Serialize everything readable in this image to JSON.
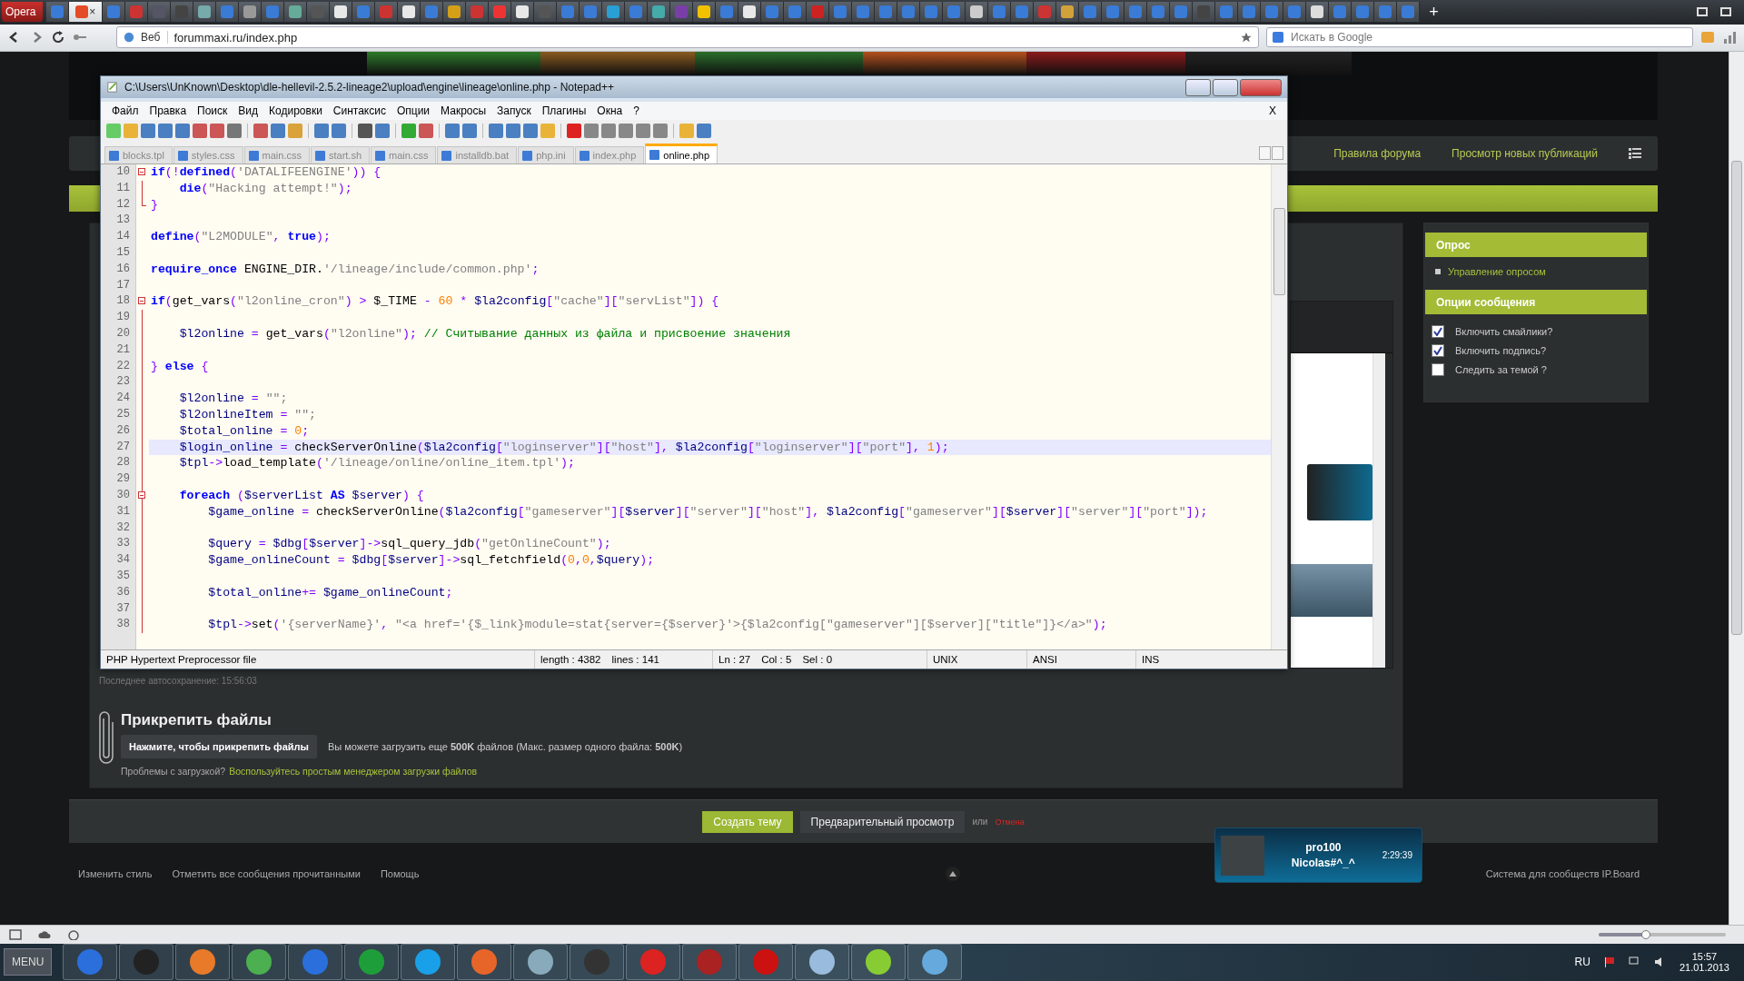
{
  "browser": {
    "menu_button": "Opera",
    "tabs": [
      {
        "selected": false
      },
      {
        "selected": true,
        "close": "×"
      },
      {
        "selected": false
      },
      {
        "selected": false
      },
      {
        "selected": false
      },
      {
        "selected": false
      },
      {
        "selected": false
      },
      {
        "selected": false
      },
      {
        "selected": false
      },
      {
        "selected": false
      },
      {
        "selected": false
      },
      {
        "selected": false
      },
      {
        "selected": false
      },
      {
        "selected": false
      },
      {
        "selected": false
      },
      {
        "selected": false
      },
      {
        "selected": false
      },
      {
        "selected": false
      },
      {
        "selected": false
      },
      {
        "selected": false
      },
      {
        "selected": false
      },
      {
        "selected": false
      },
      {
        "selected": false
      },
      {
        "selected": false
      },
      {
        "selected": false
      },
      {
        "selected": false
      },
      {
        "selected": false
      },
      {
        "selected": false
      },
      {
        "selected": false
      },
      {
        "selected": false
      },
      {
        "selected": false
      },
      {
        "selected": false
      },
      {
        "selected": false
      },
      {
        "selected": false
      },
      {
        "selected": false
      },
      {
        "selected": false
      },
      {
        "selected": false
      },
      {
        "selected": false
      },
      {
        "selected": false
      },
      {
        "selected": false
      },
      {
        "selected": false
      },
      {
        "selected": false
      },
      {
        "selected": false
      },
      {
        "selected": false
      },
      {
        "selected": false
      },
      {
        "selected": false
      },
      {
        "selected": false
      },
      {
        "selected": false
      },
      {
        "selected": false
      },
      {
        "selected": false
      },
      {
        "selected": false
      },
      {
        "selected": false
      },
      {
        "selected": false
      },
      {
        "selected": false
      },
      {
        "selected": false
      },
      {
        "selected": false
      },
      {
        "selected": false
      },
      {
        "selected": false
      },
      {
        "selected": false
      },
      {
        "selected": false
      }
    ],
    "new_tab": "+",
    "address": {
      "label": "Веб",
      "url": "forummaxi.ru/index.php"
    },
    "search": {
      "placeholder": "Искать в Google"
    },
    "zoom_slider": {
      "level": 0.37
    }
  },
  "forum": {
    "nav_links": [
      "Правила форума",
      "Просмотр новых публикаций"
    ],
    "sidebar": [
      {
        "title": "Опрос",
        "kind": "links",
        "items": [
          {
            "label": "Управление опросом"
          }
        ]
      },
      {
        "title": "Опции сообщения",
        "kind": "checkboxes",
        "items": [
          {
            "label": "Включить смайлики?",
            "checked": true
          },
          {
            "label": "Включить подпись?",
            "checked": true
          },
          {
            "label": "Следить за темой ?",
            "checked": false
          }
        ]
      }
    ],
    "autosave": "Последнее автосохранение: 15:56:03",
    "attach": {
      "title": "Прикрепить файлы",
      "button": "Нажмите, чтобы прикрепить файлы",
      "info": "Вы можете загрузить еще **500K** файлов (Макс. размер одного файла: **500K**)",
      "problem": "Проблемы с загрузкой?",
      "link": "Воспользуйтесь простым менеджером загрузки файлов"
    },
    "actions": {
      "submit": "Создать тему",
      "preview": "Предварительный просмотр",
      "or": "или",
      "cancel": "Отмена"
    },
    "footer": {
      "links": [
        "Изменить стиль",
        "Отметить все сообщения прочитанными",
        "Помощь"
      ],
      "credit": "Система для сообществ IP.Board"
    },
    "toast": {
      "line_1": "pro100",
      "line_2": "Nicolas#^_^",
      "time": "2:29:39"
    }
  },
  "notepad": {
    "title": "C:\\Users\\UnKnown\\Desktop\\dle-hellevil-2.5.2-lineage2\\upload\\engine\\lineage\\online.php - Notepad++",
    "menu": [
      "Файл",
      "Правка",
      "Поиск",
      "Вид",
      "Кодировки",
      "Синтаксис",
      "Опции",
      "Макросы",
      "Запуск",
      "Плагины",
      "Окна",
      "?"
    ],
    "menu_close": "X",
    "tabs": [
      {
        "label": "blocks.tpl",
        "selected": false
      },
      {
        "label": "styles.css",
        "selected": false
      },
      {
        "label": "main.css",
        "selected": false
      },
      {
        "label": "start.sh",
        "selected": false
      },
      {
        "label": "main.css",
        "selected": false
      },
      {
        "label": "installdb.bat",
        "selected": false
      },
      {
        "label": "php.ini",
        "selected": false
      },
      {
        "label": "index.php",
        "selected": false
      },
      {
        "label": "online.php",
        "selected": true
      }
    ],
    "lines": [
      {
        "n": "10",
        "kind": "start",
        "current": false,
        "tokens": [
          {
            "kind": "kw",
            "text": "if"
          },
          {
            "kind": "op",
            "text": "(!"
          },
          {
            "kind": "kw",
            "text": "defined"
          },
          {
            "kind": "op",
            "text": "("
          },
          {
            "kind": "str",
            "text": "'DATALIFEENGINE'"
          },
          {
            "kind": "op",
            "text": ")) {"
          }
        ]
      },
      {
        "n": "11",
        "kind": "body",
        "current": false,
        "tokens": [
          {
            "kind": "kw",
            "text": "    die"
          },
          {
            "kind": "op",
            "text": "("
          },
          {
            "kind": "str",
            "text": "\"Hacking attempt!\""
          },
          {
            "kind": "op",
            "text": ");"
          }
        ]
      },
      {
        "n": "12",
        "kind": "end",
        "current": false,
        "tokens": [
          {
            "kind": "op",
            "text": "}"
          }
        ]
      },
      {
        "n": "13",
        "kind": "none",
        "current": false
      },
      {
        "n": "14",
        "kind": "none",
        "current": false,
        "tokens": [
          {
            "kind": "kw",
            "text": "define"
          },
          {
            "kind": "op",
            "text": "("
          },
          {
            "kind": "str",
            "text": "\"L2MODULE\""
          },
          {
            "kind": "op",
            "text": ", "
          },
          {
            "kind": "kw",
            "text": "true"
          },
          {
            "kind": "op",
            "text": ");"
          }
        ]
      },
      {
        "n": "15",
        "kind": "none",
        "current": false
      },
      {
        "n": "16",
        "kind": "none",
        "current": false,
        "tokens": [
          {
            "kind": "kw",
            "text": "require_once"
          },
          {
            "kind": "plain",
            "text": " ENGINE_DIR."
          },
          {
            "kind": "str",
            "text": "'/lineage/include/common.php'"
          },
          {
            "kind": "op",
            "text": ";"
          }
        ]
      },
      {
        "n": "17",
        "kind": "none",
        "current": false
      },
      {
        "n": "18",
        "kind": "start",
        "current": false,
        "tokens": [
          {
            "kind": "kw",
            "text": "if"
          },
          {
            "kind": "op",
            "text": "("
          },
          {
            "kind": "plain",
            "text": "get_vars"
          },
          {
            "kind": "op",
            "text": "("
          },
          {
            "kind": "str",
            "text": "\"l2online_cron\""
          },
          {
            "kind": "op",
            "text": ") > "
          },
          {
            "kind": "plain",
            "text": "$_TIME"
          },
          {
            "kind": "op",
            "text": " - "
          },
          {
            "kind": "num",
            "text": "60"
          },
          {
            "kind": "op",
            "text": " * "
          },
          {
            "kind": "var",
            "text": "$la2config"
          },
          {
            "kind": "op",
            "text": "["
          },
          {
            "kind": "str",
            "text": "\"cache\""
          },
          {
            "kind": "op",
            "text": "]["
          },
          {
            "kind": "str",
            "text": "\"servList\""
          },
          {
            "kind": "op",
            "text": "]) {"
          }
        ]
      },
      {
        "n": "19",
        "kind": "body",
        "current": false
      },
      {
        "n": "20",
        "kind": "body",
        "current": false,
        "tokens": [
          {
            "kind": "var",
            "text": "    $l2online"
          },
          {
            "kind": "op",
            "text": " = "
          },
          {
            "kind": "plain",
            "text": "get_vars"
          },
          {
            "kind": "op",
            "text": "("
          },
          {
            "kind": "str",
            "text": "\"l2online\""
          },
          {
            "kind": "op",
            "text": "); "
          },
          {
            "kind": "com",
            "text": "// Считывание данных из файла и присвоение значения"
          }
        ]
      },
      {
        "n": "21",
        "kind": "body",
        "current": false
      },
      {
        "n": "22",
        "kind": "body",
        "current": false,
        "tokens": [
          {
            "kind": "op",
            "text": "} "
          },
          {
            "kind": "kw",
            "text": "else"
          },
          {
            "kind": "op",
            "text": " {"
          }
        ]
      },
      {
        "n": "23",
        "kind": "body",
        "current": false
      },
      {
        "n": "24",
        "kind": "body",
        "current": false,
        "tokens": [
          {
            "kind": "var",
            "text": "    $l2online"
          },
          {
            "kind": "op",
            "text": " = "
          },
          {
            "kind": "str",
            "text": "\"\";"
          }
        ]
      },
      {
        "n": "25",
        "kind": "body",
        "current": false,
        "tokens": [
          {
            "kind": "var",
            "text": "    $l2onlineItem"
          },
          {
            "kind": "op",
            "text": " = "
          },
          {
            "kind": "str",
            "text": "\"\";"
          }
        ]
      },
      {
        "n": "26",
        "kind": "body",
        "current": false,
        "tokens": [
          {
            "kind": "var",
            "text": "    $total_online"
          },
          {
            "kind": "op",
            "text": " = "
          },
          {
            "kind": "num",
            "text": "0"
          },
          {
            "kind": "op",
            "text": ";"
          }
        ]
      },
      {
        "n": "27",
        "kind": "body",
        "current": true,
        "tokens": [
          {
            "kind": "var",
            "text": "    $login_online"
          },
          {
            "kind": "op",
            "text": " = "
          },
          {
            "kind": "plain",
            "text": "checkServerOnline"
          },
          {
            "kind": "op",
            "text": "("
          },
          {
            "kind": "var",
            "text": "$la2config"
          },
          {
            "kind": "op",
            "text": "["
          },
          {
            "kind": "str",
            "text": "\"loginserver\""
          },
          {
            "kind": "op",
            "text": "]["
          },
          {
            "kind": "str",
            "text": "\"host\""
          },
          {
            "kind": "op",
            "text": "], "
          },
          {
            "kind": "var",
            "text": "$la2config"
          },
          {
            "kind": "op",
            "text": "["
          },
          {
            "kind": "str",
            "text": "\"loginserver\""
          },
          {
            "kind": "op",
            "text": "]["
          },
          {
            "kind": "str",
            "text": "\"port\""
          },
          {
            "kind": "op",
            "text": "], "
          },
          {
            "kind": "num",
            "text": "1"
          },
          {
            "kind": "op",
            "text": ");"
          }
        ]
      },
      {
        "n": "28",
        "kind": "body",
        "current": false,
        "tokens": [
          {
            "kind": "var",
            "text": "    $tpl"
          },
          {
            "kind": "op",
            "text": "->"
          },
          {
            "kind": "plain",
            "text": "load_template"
          },
          {
            "kind": "op",
            "text": "("
          },
          {
            "kind": "str",
            "text": "'/lineage/online/online_item.tpl'"
          },
          {
            "kind": "op",
            "text": ");"
          }
        ]
      },
      {
        "n": "29",
        "kind": "body",
        "current": false
      },
      {
        "n": "30",
        "kind": "start",
        "current": false,
        "tokens": [
          {
            "kind": "kw",
            "text": "    foreach"
          },
          {
            "kind": "op",
            "text": " ("
          },
          {
            "kind": "var",
            "text": "$serverList"
          },
          {
            "kind": "kw",
            "text": " AS"
          },
          {
            "kind": "var",
            "text": " $server"
          },
          {
            "kind": "op",
            "text": ") {"
          }
        ]
      },
      {
        "n": "31",
        "kind": "body",
        "current": false,
        "tokens": [
          {
            "kind": "var",
            "text": "        $game_online"
          },
          {
            "kind": "op",
            "text": " = "
          },
          {
            "kind": "plain",
            "text": "checkServerOnline"
          },
          {
            "kind": "op",
            "text": "("
          },
          {
            "kind": "var",
            "text": "$la2config"
          },
          {
            "kind": "op",
            "text": "["
          },
          {
            "kind": "str",
            "text": "\"gameserver\""
          },
          {
            "kind": "op",
            "text": "]["
          },
          {
            "kind": "var",
            "text": "$server"
          },
          {
            "kind": "op",
            "text": "]["
          },
          {
            "kind": "str",
            "text": "\"server\""
          },
          {
            "kind": "op",
            "text": "]["
          },
          {
            "kind": "str",
            "text": "\"host\""
          },
          {
            "kind": "op",
            "text": "], "
          },
          {
            "kind": "var",
            "text": "$la2config"
          },
          {
            "kind": "op",
            "text": "["
          },
          {
            "kind": "str",
            "text": "\"gameserver\""
          },
          {
            "kind": "op",
            "text": "]["
          },
          {
            "kind": "var",
            "text": "$server"
          },
          {
            "kind": "op",
            "text": "]["
          },
          {
            "kind": "str",
            "text": "\"server\""
          },
          {
            "kind": "op",
            "text": "]["
          },
          {
            "kind": "str",
            "text": "\"port\""
          },
          {
            "kind": "op",
            "text": "]);"
          }
        ]
      },
      {
        "n": "32",
        "kind": "body",
        "current": false
      },
      {
        "n": "33",
        "kind": "body",
        "current": false,
        "tokens": [
          {
            "kind": "var",
            "text": "        $query"
          },
          {
            "kind": "op",
            "text": " = "
          },
          {
            "kind": "var",
            "text": "$dbg"
          },
          {
            "kind": "op",
            "text": "["
          },
          {
            "kind": "var",
            "text": "$server"
          },
          {
            "kind": "op",
            "text": "]->"
          },
          {
            "kind": "plain",
            "text": "sql_query_jdb"
          },
          {
            "kind": "op",
            "text": "("
          },
          {
            "kind": "str",
            "text": "\"getOnlineCount\""
          },
          {
            "kind": "op",
            "text": ");"
          }
        ]
      },
      {
        "n": "34",
        "kind": "body",
        "current": false,
        "tokens": [
          {
            "kind": "var",
            "text": "        $game_onlineCount"
          },
          {
            "kind": "op",
            "text": " = "
          },
          {
            "kind": "var",
            "text": "$dbg"
          },
          {
            "kind": "op",
            "text": "["
          },
          {
            "kind": "var",
            "text": "$server"
          },
          {
            "kind": "op",
            "text": "]->"
          },
          {
            "kind": "plain",
            "text": "sql_fetchfield"
          },
          {
            "kind": "op",
            "text": "("
          },
          {
            "kind": "num",
            "text": "0"
          },
          {
            "kind": "op",
            "text": ","
          },
          {
            "kind": "num",
            "text": "0"
          },
          {
            "kind": "op",
            "text": ","
          },
          {
            "kind": "var",
            "text": "$query"
          },
          {
            "kind": "op",
            "text": ");"
          }
        ]
      },
      {
        "n": "35",
        "kind": "body",
        "current": false
      },
      {
        "n": "36",
        "kind": "body",
        "current": false,
        "tokens": [
          {
            "kind": "var",
            "text": "        $total_online"
          },
          {
            "kind": "op",
            "text": "+= "
          },
          {
            "kind": "var",
            "text": "$game_onlineCount"
          },
          {
            "kind": "op",
            "text": ";"
          }
        ]
      },
      {
        "n": "37",
        "kind": "body",
        "current": false
      },
      {
        "n": "38",
        "kind": "body",
        "current": false,
        "tokens": [
          {
            "kind": "var",
            "text": "        $tpl"
          },
          {
            "kind": "op",
            "text": "->"
          },
          {
            "kind": "plain",
            "text": "set"
          },
          {
            "kind": "op",
            "text": "("
          },
          {
            "kind": "str",
            "text": "'{serverName}'"
          },
          {
            "kind": "op",
            "text": ", "
          },
          {
            "kind": "str",
            "text": "\"<a href='{$_link}module=stat{server={$server}'>{$la2config[\"gameserver\"][$server][\"title\"]}</a>\""
          },
          {
            "kind": "op",
            "text": ");"
          }
        ]
      }
    ],
    "status": {
      "type": "PHP Hypertext Preprocessor file",
      "length": "length : 4382",
      "lines": "lines : 141",
      "ln": "Ln : 27",
      "col": "Col : 5",
      "sel": "Sel : 0",
      "eol": "UNIX",
      "encoding": "ANSI",
      "mode": "INS"
    }
  },
  "taskbar": {
    "start": "MENU",
    "language": "RU",
    "time": "15:57",
    "date": "21.01.2013"
  }
}
